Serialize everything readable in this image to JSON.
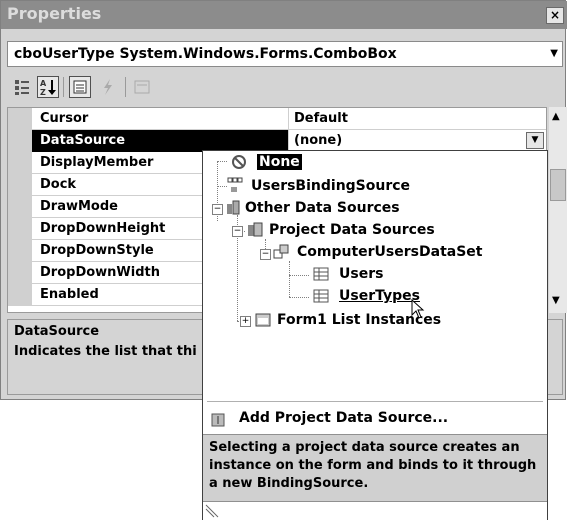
{
  "window": {
    "title": "Properties",
    "close": "×"
  },
  "object_selector": {
    "value": "cboUserType  System.Windows.Forms.ComboBox"
  },
  "toolbar": {
    "buttons": [
      "categorized-icon",
      "alphabetical-icon",
      "properties-icon",
      "events-icon",
      "property-pages-icon"
    ]
  },
  "grid": {
    "rows": [
      {
        "name": "Cursor",
        "value": "Default"
      },
      {
        "name": "DataSource",
        "value": "(none)"
      },
      {
        "name": "DisplayMember",
        "value": ""
      },
      {
        "name": "Dock",
        "value": ""
      },
      {
        "name": "DrawMode",
        "value": ""
      },
      {
        "name": "DropDownHeight",
        "value": ""
      },
      {
        "name": "DropDownStyle",
        "value": ""
      },
      {
        "name": "DropDownWidth",
        "value": ""
      },
      {
        "name": "Enabled",
        "value": ""
      }
    ]
  },
  "description": {
    "title": "DataSource",
    "text": "Indicates the list that thi"
  },
  "popup": {
    "tree": {
      "none": "None",
      "binding_source": "UsersBindingSource",
      "other_sources": "Other Data Sources",
      "project_sources": "Project Data Sources",
      "dataset": "ComputerUsersDataSet",
      "users": "Users",
      "usertypes": "UserTypes",
      "form_instances": "Form1 List Instances"
    },
    "add_source": "Add Project Data Source...",
    "help": "Selecting a project data source creates an instance on the form and binds to it through a new BindingSource."
  },
  "colors": {
    "title_bar": "#8c8c8c",
    "selected": "#000000",
    "panel": "#d4d4d4"
  }
}
